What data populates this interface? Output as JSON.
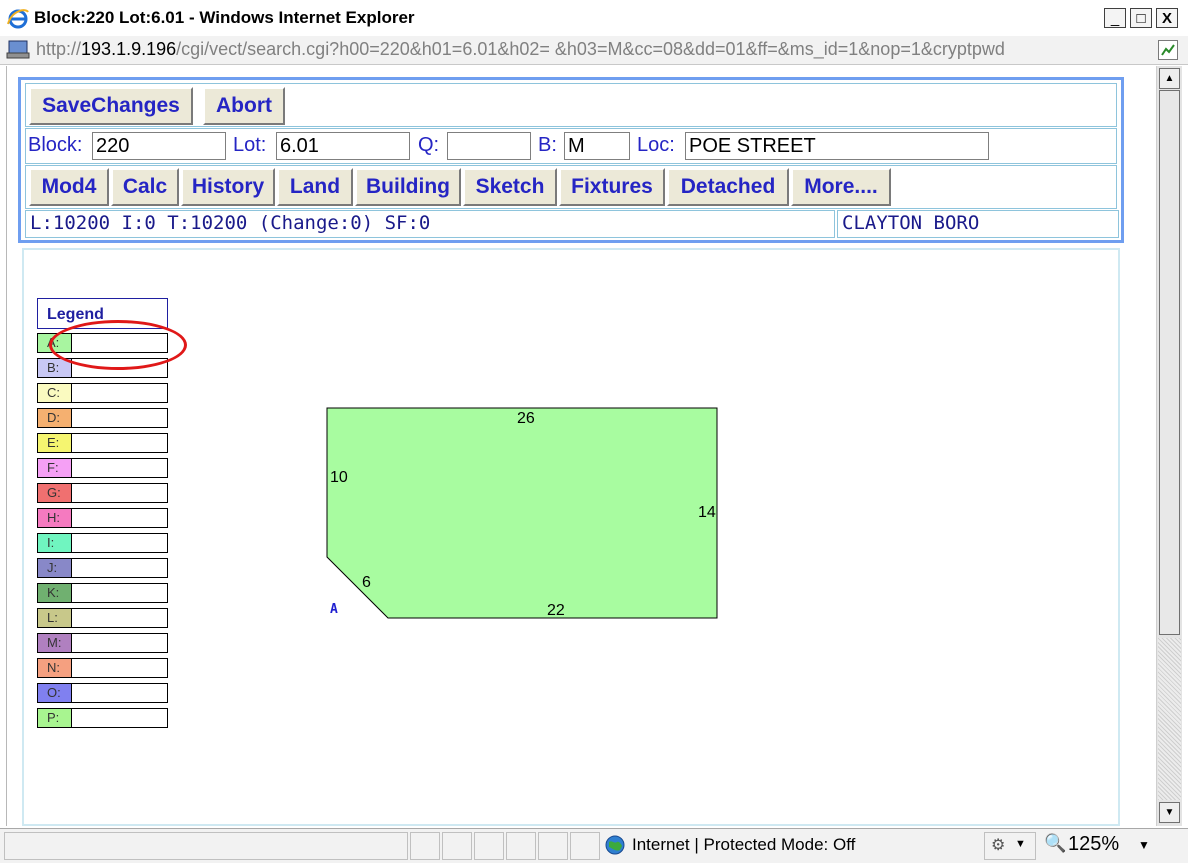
{
  "window": {
    "title": "Block:220 Lot:6.01 - Windows Internet Explorer",
    "controls": {
      "minimize": "_",
      "maximize": "□",
      "close": "X"
    }
  },
  "address": {
    "host": "193.1.9.196",
    "prefix": "http://",
    "path": "/cgi/vect/search.cgi?h00=220&h01=6.01&h02= &h03=M&cc=08&dd=01&ff=&ms_id=1&nop=1&cryptpwd"
  },
  "toolbar": {
    "save_label": "SaveChanges",
    "abort_label": "Abort"
  },
  "fields": {
    "block_label": "Block:",
    "block_value": "220",
    "lot_label": "Lot:",
    "lot_value": "6.01",
    "q_label": "Q:",
    "q_value": "",
    "b_label": "B:",
    "b_value": "M",
    "loc_label": "Loc:",
    "loc_value": "POE STREET"
  },
  "nav": [
    "Mod4",
    "Calc",
    "History",
    "Land",
    "Building",
    "Sketch",
    "Fixtures",
    "Detached",
    "More...."
  ],
  "status": {
    "summary": "L:10200 I:0 T:10200 (Change:0) SF:0",
    "municipality": "CLAYTON BORO"
  },
  "legend": {
    "title": "Legend",
    "items": [
      {
        "letter": "A:",
        "color": "#a8f5a0"
      },
      {
        "letter": "B:",
        "color": "#c8c8f5"
      },
      {
        "letter": "C:",
        "color": "#fafac0"
      },
      {
        "letter": "D:",
        "color": "#f5b070"
      },
      {
        "letter": "E:",
        "color": "#f5f570"
      },
      {
        "letter": "F:",
        "color": "#f5a0f5"
      },
      {
        "letter": "G:",
        "color": "#f07070"
      },
      {
        "letter": "H:",
        "color": "#f57ac0"
      },
      {
        "letter": "I:",
        "color": "#70f5c0"
      },
      {
        "letter": "J:",
        "color": "#8888c8"
      },
      {
        "letter": "K:",
        "color": "#70b070"
      },
      {
        "letter": "L:",
        "color": "#c8c88a"
      },
      {
        "letter": "M:",
        "color": "#b080c0"
      },
      {
        "letter": "N:",
        "color": "#f5a080"
      },
      {
        "letter": "O:",
        "color": "#8080f0"
      },
      {
        "letter": "P:",
        "color": "#a8f590"
      }
    ]
  },
  "sketch": {
    "fill": "#a8fca0",
    "area_label": "A",
    "dimensions": {
      "top": "26",
      "left": "10",
      "right": "14",
      "diagonal": "6",
      "bottom": "22"
    }
  },
  "statusbar": {
    "zone": "Internet | Protected Mode: Off",
    "zoom": "125%"
  }
}
